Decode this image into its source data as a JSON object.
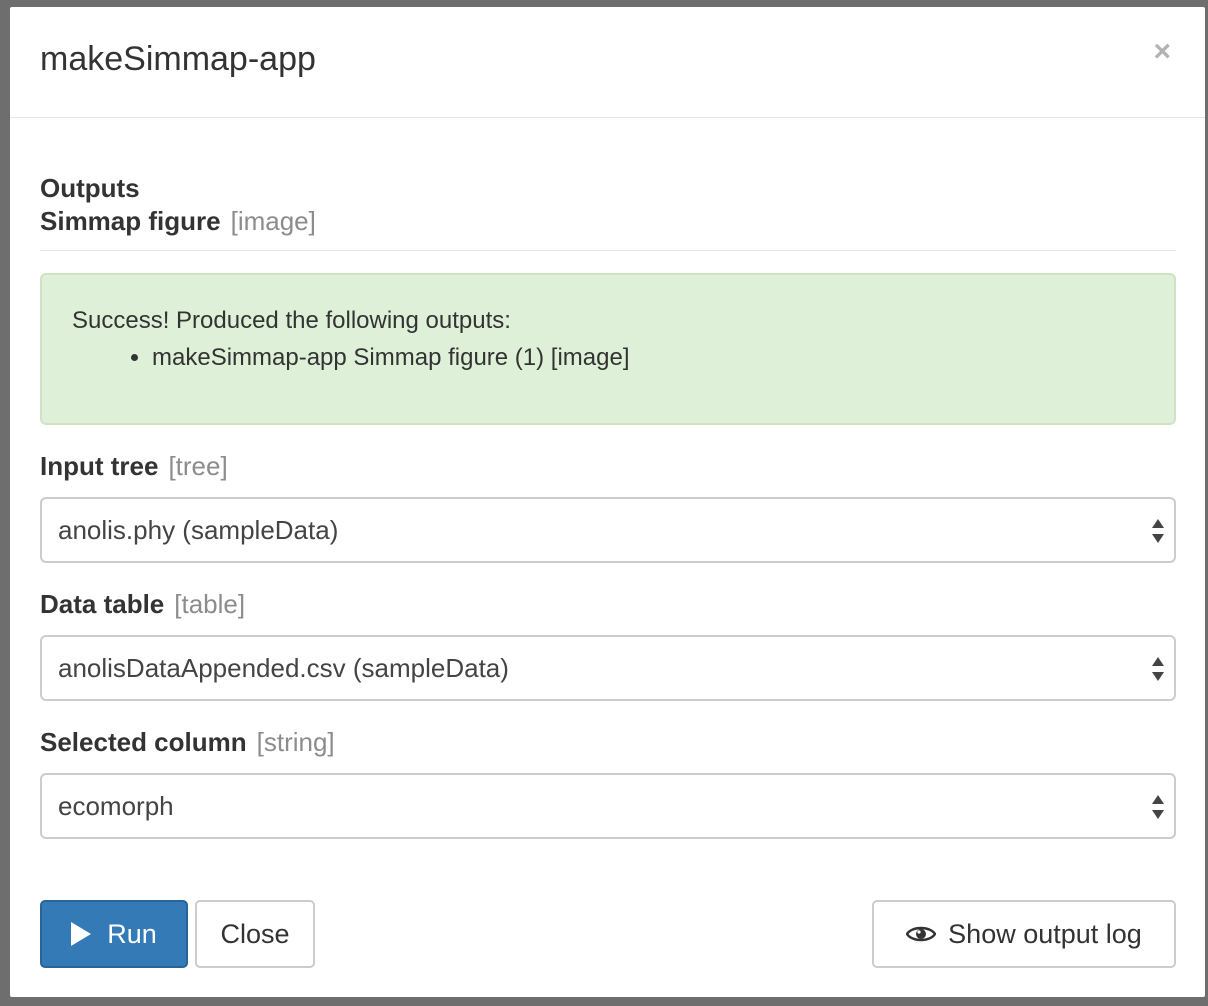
{
  "modal": {
    "title": "makeSimmap-app",
    "close_symbol": "×"
  },
  "outputs": {
    "heading": "Outputs",
    "figure_label": "Simmap figure",
    "figure_type": "[image]"
  },
  "alert": {
    "message": "Success! Produced the following outputs:",
    "items": [
      "makeSimmap-app Simmap figure (1) [image]"
    ]
  },
  "fields": [
    {
      "label": "Input tree",
      "type": "[tree]",
      "value": "anolis.phy (sampleData)"
    },
    {
      "label": "Data table",
      "type": "[table]",
      "value": "anolisDataAppended.csv (sampleData)"
    },
    {
      "label": "Selected column",
      "type": "[string]",
      "value": "ecomorph"
    }
  ],
  "buttons": {
    "run": "Run",
    "close": "Close",
    "show_log": "Show output log"
  },
  "colors": {
    "primary": "#337ab7",
    "success_bg": "#dff0d8"
  },
  "icons": {
    "run": "play-icon",
    "log": "eye-icon",
    "select": "sort-arrows-icon"
  }
}
